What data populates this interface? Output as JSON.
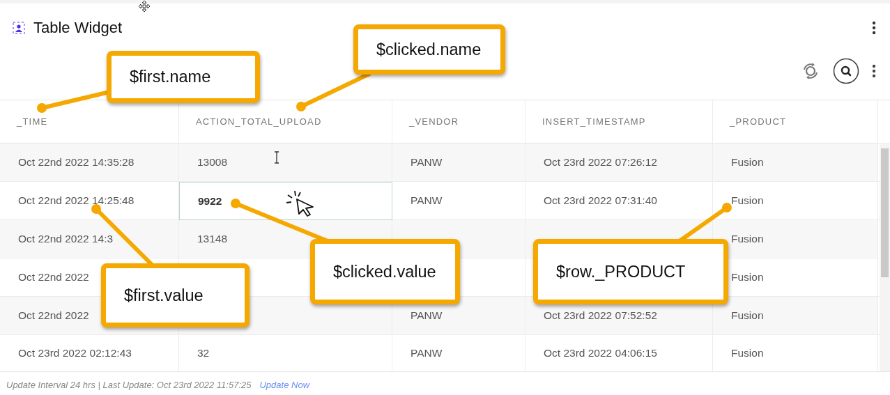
{
  "widget": {
    "title": "Table Widget"
  },
  "table": {
    "columns": [
      "_TIME",
      "ACTION_TOTAL_UPLOAD",
      "_VENDOR",
      "INSERT_TIMESTAMP",
      "_PRODUCT"
    ],
    "rows": [
      {
        "cells": [
          {
            "text": "Oct 22nd 2022 14:35:28",
            "selected": false
          },
          {
            "text": "13008",
            "selected": false
          },
          {
            "text": "PANW",
            "selected": false
          },
          {
            "text": "Oct 23rd 2022 07:26:12",
            "selected": false
          },
          {
            "text": "Fusion",
            "selected": false
          }
        ]
      },
      {
        "cells": [
          {
            "text": "Oct 22nd 2022 14:25:48",
            "selected": false
          },
          {
            "text": "9922",
            "selected": true
          },
          {
            "text": "PANW",
            "selected": false
          },
          {
            "text": "Oct 23rd 2022 07:31:40",
            "selected": false
          },
          {
            "text": "Fusion",
            "selected": false
          }
        ]
      },
      {
        "cells": [
          {
            "text": "Oct 22nd 2022 14:3",
            "selected": false
          },
          {
            "text": "13148",
            "selected": false
          },
          {
            "selected": false
          },
          {
            "selected": false
          },
          {
            "text": "Fusion",
            "selected": false
          }
        ]
      },
      {
        "cells": [
          {
            "text": "Oct 22nd 2022",
            "selected": false
          },
          {
            "selected": false
          },
          {
            "selected": false
          },
          {
            "selected": false
          },
          {
            "text": "Fusion",
            "selected": false
          }
        ]
      },
      {
        "cells": [
          {
            "text": "Oct 22nd 2022",
            "selected": false
          },
          {
            "selected": false
          },
          {
            "text": "PANW",
            "selected": false
          },
          {
            "text": "Oct 23rd 2022 07:52:52",
            "selected": false
          },
          {
            "text": "Fusion",
            "selected": false
          }
        ]
      },
      {
        "cells": [
          {
            "text": "Oct 23rd 2022 02:12:43",
            "selected": false
          },
          {
            "text": "32",
            "selected": false
          },
          {
            "text": "PANW",
            "selected": false
          },
          {
            "text": "Oct 23rd 2022 04:06:15",
            "selected": false
          },
          {
            "text": "Fusion",
            "selected": false
          }
        ]
      }
    ]
  },
  "footer": {
    "status": "Update Interval 24 hrs | Last Update: Oct 23rd 2022 11:57:25",
    "link": "Update Now"
  },
  "callouts": [
    {
      "text": "$first.name"
    },
    {
      "text": "$clicked.name"
    },
    {
      "text": "$first.value"
    },
    {
      "text": "$clicked.value"
    },
    {
      "text": "$row._PRODUCT"
    }
  ]
}
